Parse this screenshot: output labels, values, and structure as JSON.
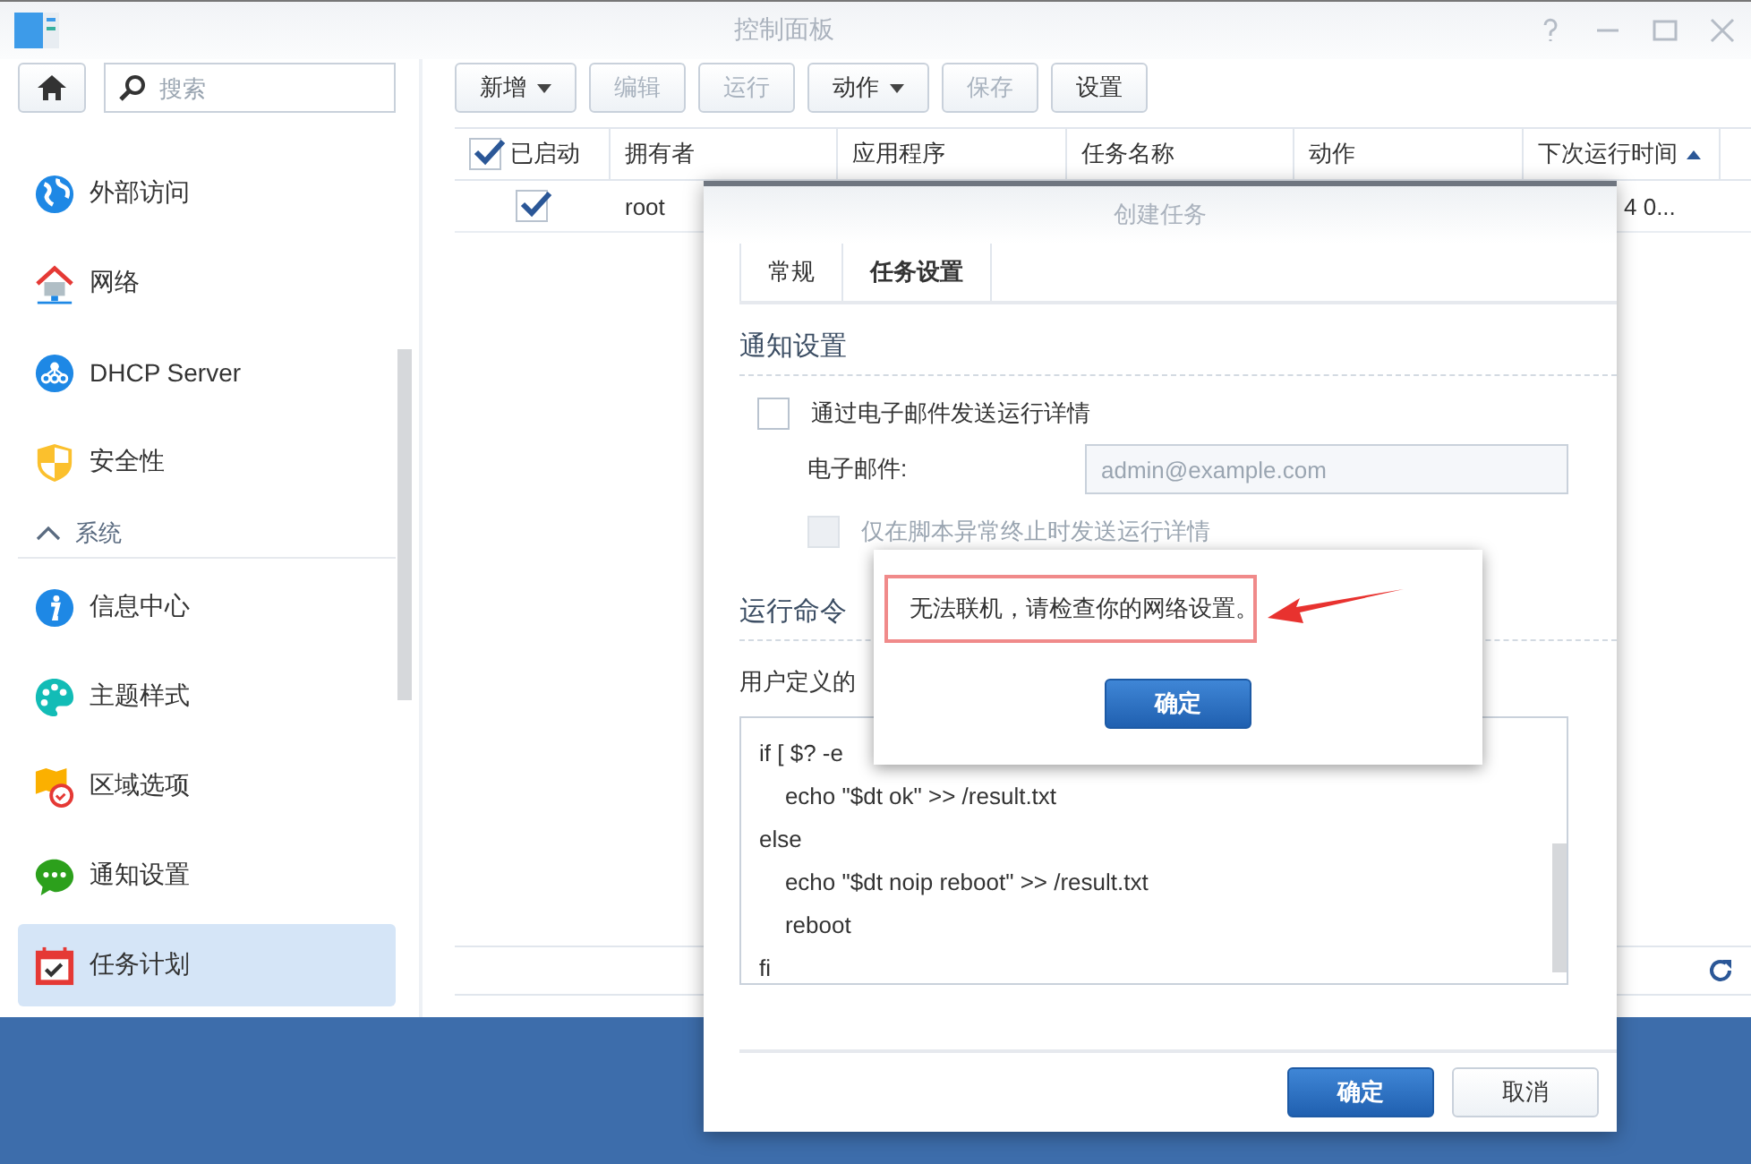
{
  "window": {
    "title": "控制面板"
  },
  "sidebar": {
    "search": {
      "placeholder": "搜索"
    },
    "items": [
      {
        "kind": "item",
        "label": "外部访问",
        "selected": false
      },
      {
        "kind": "item",
        "label": "网络",
        "selected": false
      },
      {
        "kind": "item",
        "label": "DHCP Server",
        "selected": false
      },
      {
        "kind": "item",
        "label": "安全性",
        "selected": false
      },
      {
        "kind": "section",
        "label": "系统",
        "expanded": true
      },
      {
        "kind": "item",
        "label": "信息中心",
        "selected": false
      },
      {
        "kind": "item",
        "label": "主题样式",
        "selected": false
      },
      {
        "kind": "item",
        "label": "区域选项",
        "selected": false
      },
      {
        "kind": "item",
        "label": "通知设置",
        "selected": false
      },
      {
        "kind": "item",
        "label": "任务计划",
        "selected": true
      }
    ]
  },
  "toolbar": {
    "buttons": [
      {
        "label": "新增",
        "dropdown": true,
        "disabled": false
      },
      {
        "label": "编辑",
        "dropdown": false,
        "disabled": true
      },
      {
        "label": "运行",
        "dropdown": false,
        "disabled": true
      },
      {
        "label": "动作",
        "dropdown": true,
        "disabled": false
      },
      {
        "label": "保存",
        "dropdown": false,
        "disabled": true
      },
      {
        "label": "设置",
        "dropdown": false,
        "disabled": false
      }
    ]
  },
  "table": {
    "select_all_checked": true,
    "columns": [
      {
        "label": "已启动",
        "sorted": false
      },
      {
        "label": "拥有者",
        "sorted": false
      },
      {
        "label": "应用程序",
        "sorted": false
      },
      {
        "label": "任务名称",
        "sorted": false
      },
      {
        "label": "动作",
        "sorted": false
      },
      {
        "label": "下次运行时间",
        "sorted": true
      }
    ],
    "rows": [
      {
        "enabled": true,
        "owner": "root",
        "next_run": "4 0..."
      }
    ]
  },
  "dialog": {
    "title": "创建任务",
    "tabs": [
      {
        "label": "常规",
        "selected": false
      },
      {
        "label": "任务设置",
        "selected": true
      }
    ],
    "notify": {
      "heading": "通知设置",
      "send_email": {
        "label": "通过电子邮件发送运行详情",
        "checked": false
      },
      "email": {
        "label": "电子邮件:",
        "placeholder": "admin@example.com"
      },
      "only_on_error": {
        "label": "仅在脚本异常终止时发送运行详情",
        "checked": false,
        "disabled": true
      }
    },
    "command": {
      "heading": "运行命令",
      "label": "用户定义的",
      "lines": [
        "if [ $? -e",
        "    echo \"$dt ok\" >> /result.txt",
        "else",
        "    echo \"$dt noip reboot\" >> /result.txt",
        "    reboot",
        "fi"
      ]
    },
    "buttons": [
      {
        "label": "确定",
        "primary": true
      },
      {
        "label": "取消",
        "primary": false
      }
    ]
  },
  "alert": {
    "message": "无法联机，请检查你的网络设置。",
    "button": "确定"
  }
}
